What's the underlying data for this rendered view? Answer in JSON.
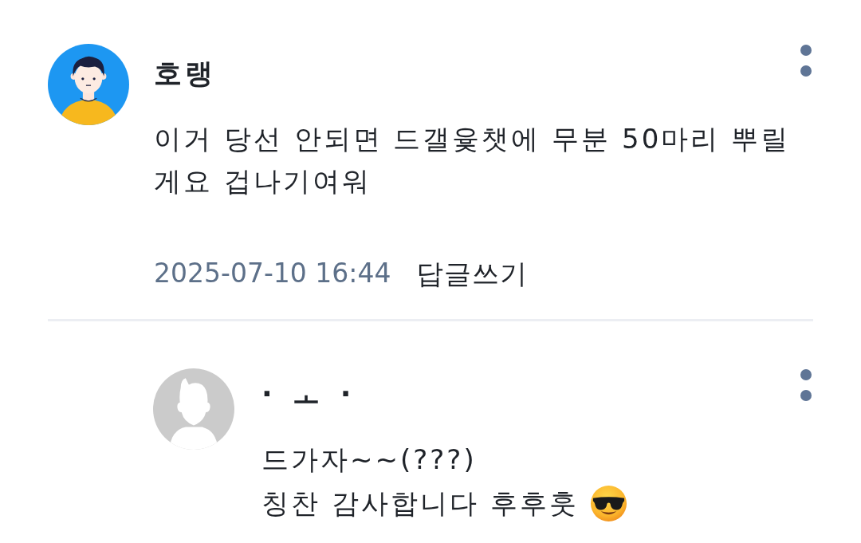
{
  "comments": [
    {
      "author": "호랭",
      "avatar": {
        "kind": "cartoon"
      },
      "body": "이거 당선 안되면 드갤윷챗에 무분 50마리 뿌릴 게요 겁나기여워",
      "timestamp": "2025-07-10 16:44",
      "reply_action": "답글쓰기",
      "replies": [
        {
          "author": "· ㅗ ·",
          "avatar": {
            "kind": "default"
          },
          "lines": [
            {
              "kind": "plain",
              "text": "드가자~~(???)"
            },
            {
              "kind": "emoji",
              "text": "칭찬 감사합니다 후후훗"
            }
          ]
        }
      ]
    }
  ]
}
